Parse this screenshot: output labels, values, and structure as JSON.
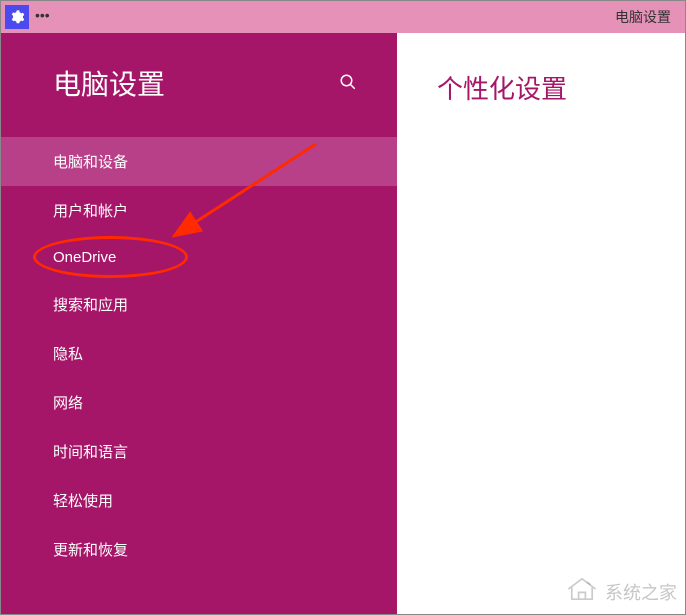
{
  "titlebar": {
    "app_title": "电脑设置",
    "menu_dots": "•••"
  },
  "sidebar": {
    "title": "电脑设置",
    "items": [
      {
        "label": "电脑和设备",
        "selected": true
      },
      {
        "label": "用户和帐户",
        "selected": false,
        "highlighted": true
      },
      {
        "label": "OneDrive",
        "selected": false
      },
      {
        "label": "搜索和应用",
        "selected": false
      },
      {
        "label": "隐私",
        "selected": false
      },
      {
        "label": "网络",
        "selected": false
      },
      {
        "label": "时间和语言",
        "selected": false
      },
      {
        "label": "轻松使用",
        "selected": false
      },
      {
        "label": "更新和恢复",
        "selected": false
      }
    ]
  },
  "main": {
    "title": "个性化设置"
  },
  "watermark": {
    "text": "系统之家"
  },
  "colors": {
    "accent": "#a61668",
    "titlebar": "#e691b8",
    "selected": "#b84088",
    "annotation": "#ff2a00"
  }
}
